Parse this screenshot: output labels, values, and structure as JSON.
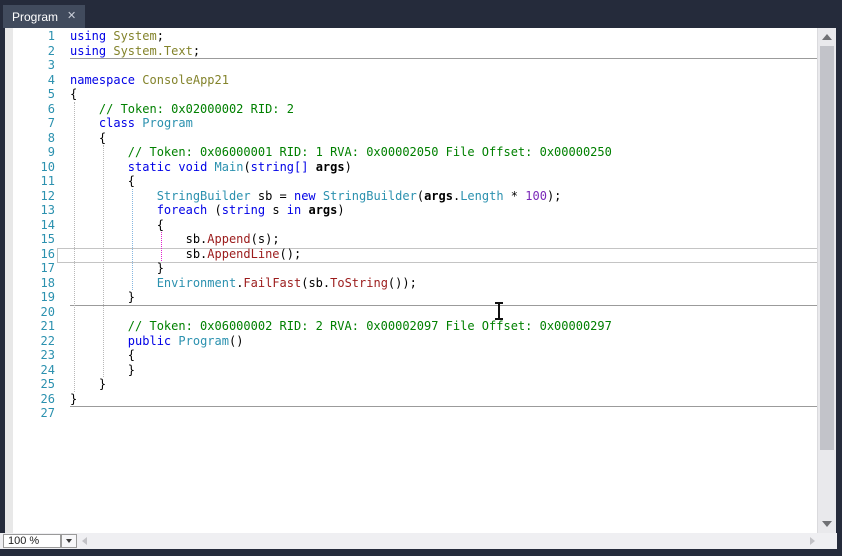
{
  "tab": {
    "title": "Program",
    "close_glyph": "✕"
  },
  "colors": {
    "keyword": "#0000E6",
    "namespace": "#83832B",
    "type": "#2B91AF",
    "method": "#9B1B1B",
    "comment": "#008000",
    "number": "#7A28B8",
    "plain": "#000000",
    "line_number": "#2B91AF",
    "guide_gray": "#B8B8B8",
    "guide_blue": "#86B7E0",
    "guide_magenta": "#E224CE",
    "frame": "#252B3B",
    "active_tab": "#414B5D"
  },
  "editor": {
    "line_count": 27,
    "current_line": 16,
    "separators_after": [
      2,
      19,
      26
    ],
    "indent_guides": [
      {
        "level": 0,
        "from": 6,
        "to": 25,
        "color": "gray"
      },
      {
        "level": 1,
        "from": 9,
        "to": 24,
        "color": "gray"
      },
      {
        "level": 2,
        "from": 12,
        "to": 18,
        "color": "blue"
      },
      {
        "level": 3,
        "from": 15,
        "to": 16,
        "color": "magenta"
      }
    ],
    "lines": [
      {
        "n": 1,
        "segs": [
          [
            "kw",
            "using"
          ],
          [
            "pl",
            " "
          ],
          [
            "ns",
            "System"
          ],
          [
            "pl",
            ";"
          ]
        ]
      },
      {
        "n": 2,
        "segs": [
          [
            "kw",
            "using"
          ],
          [
            "pl",
            " "
          ],
          [
            "ns",
            "System.Text"
          ],
          [
            "pl",
            ";"
          ]
        ]
      },
      {
        "n": 3,
        "segs": []
      },
      {
        "n": 4,
        "segs": [
          [
            "kw",
            "namespace"
          ],
          [
            "pl",
            " "
          ],
          [
            "ns",
            "ConsoleApp21"
          ]
        ]
      },
      {
        "n": 5,
        "segs": [
          [
            "pl",
            "{"
          ]
        ]
      },
      {
        "n": 6,
        "segs": [
          [
            "pl",
            "    "
          ],
          [
            "cm",
            "// Token: 0x02000002 RID: 2"
          ]
        ]
      },
      {
        "n": 7,
        "segs": [
          [
            "pl",
            "    "
          ],
          [
            "kw",
            "class"
          ],
          [
            "pl",
            " "
          ],
          [
            "ty",
            "Program"
          ]
        ]
      },
      {
        "n": 8,
        "segs": [
          [
            "pl",
            "    {"
          ]
        ]
      },
      {
        "n": 9,
        "segs": [
          [
            "pl",
            "        "
          ],
          [
            "cm",
            "// Token: 0x06000001 RID: 1 RVA: 0x00002050 File Offset: 0x00000250"
          ]
        ]
      },
      {
        "n": 10,
        "segs": [
          [
            "pl",
            "        "
          ],
          [
            "kw",
            "static"
          ],
          [
            "pl",
            " "
          ],
          [
            "kw",
            "void"
          ],
          [
            "pl",
            " "
          ],
          [
            "ty",
            "Main"
          ],
          [
            "pl",
            "("
          ],
          [
            "kw",
            "string[]"
          ],
          [
            "pl",
            " "
          ],
          [
            "pb",
            "args"
          ],
          [
            "pl",
            ")"
          ]
        ]
      },
      {
        "n": 11,
        "segs": [
          [
            "pl",
            "        {"
          ]
        ]
      },
      {
        "n": 12,
        "segs": [
          [
            "pl",
            "            "
          ],
          [
            "ty",
            "StringBuilder"
          ],
          [
            "pl",
            " sb = "
          ],
          [
            "kw",
            "new"
          ],
          [
            "pl",
            " "
          ],
          [
            "ty",
            "StringBuilder"
          ],
          [
            "pl",
            "("
          ],
          [
            "pb",
            "args"
          ],
          [
            "pl",
            "."
          ],
          [
            "ty",
            "Length"
          ],
          [
            "pl",
            " * "
          ],
          [
            "num",
            "100"
          ],
          [
            "pl",
            ");"
          ]
        ]
      },
      {
        "n": 13,
        "segs": [
          [
            "pl",
            "            "
          ],
          [
            "kw",
            "foreach"
          ],
          [
            "pl",
            " ("
          ],
          [
            "kw",
            "string"
          ],
          [
            "pl",
            " s "
          ],
          [
            "kw",
            "in"
          ],
          [
            "pl",
            " "
          ],
          [
            "pb",
            "args"
          ],
          [
            "pl",
            ")"
          ]
        ]
      },
      {
        "n": 14,
        "segs": [
          [
            "pl",
            "            {"
          ]
        ]
      },
      {
        "n": 15,
        "segs": [
          [
            "pl",
            "                sb."
          ],
          [
            "me",
            "Append"
          ],
          [
            "pl",
            "(s);"
          ]
        ]
      },
      {
        "n": 16,
        "segs": [
          [
            "pl",
            "                sb."
          ],
          [
            "me",
            "AppendLine"
          ],
          [
            "pl",
            "();"
          ]
        ]
      },
      {
        "n": 17,
        "segs": [
          [
            "pl",
            "            }"
          ]
        ]
      },
      {
        "n": 18,
        "segs": [
          [
            "pl",
            "            "
          ],
          [
            "ty",
            "Environment"
          ],
          [
            "pl",
            "."
          ],
          [
            "me",
            "FailFast"
          ],
          [
            "pl",
            "(sb."
          ],
          [
            "me",
            "ToString"
          ],
          [
            "pl",
            "());"
          ]
        ]
      },
      {
        "n": 19,
        "segs": [
          [
            "pl",
            "        }"
          ]
        ]
      },
      {
        "n": 20,
        "segs": []
      },
      {
        "n": 21,
        "segs": [
          [
            "pl",
            "        "
          ],
          [
            "cm",
            "// Token: 0x06000002 RID: 2 RVA: 0x00002097 File Offset: 0x00000297"
          ]
        ]
      },
      {
        "n": 22,
        "segs": [
          [
            "pl",
            "        "
          ],
          [
            "kw",
            "public"
          ],
          [
            "pl",
            " "
          ],
          [
            "ty",
            "Program"
          ],
          [
            "pl",
            "()"
          ]
        ]
      },
      {
        "n": 23,
        "segs": [
          [
            "pl",
            "        {"
          ]
        ]
      },
      {
        "n": 24,
        "segs": [
          [
            "pl",
            "        }"
          ]
        ]
      },
      {
        "n": 25,
        "segs": [
          [
            "pl",
            "    }"
          ]
        ]
      },
      {
        "n": 26,
        "segs": [
          [
            "pl",
            "}"
          ]
        ]
      },
      {
        "n": 27,
        "segs": []
      }
    ]
  },
  "statusbar": {
    "zoom_value": "100 %"
  }
}
